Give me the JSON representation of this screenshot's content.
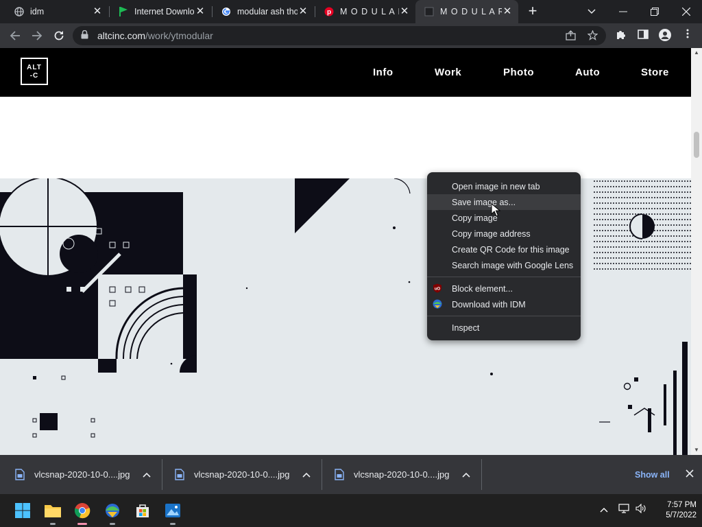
{
  "browser": {
    "tabs": [
      {
        "title": "idm",
        "favicon": "globe-icon",
        "active": false
      },
      {
        "title": "Internet Downlo",
        "favicon": "green-flag-icon",
        "active": false
      },
      {
        "title": "modular ash tho",
        "favicon": "google-icon",
        "active": false
      },
      {
        "title": "M O D U L A R",
        "favicon": "pinterest-icon",
        "active": false
      },
      {
        "title": "M O D U L A R",
        "favicon": "blank-page-icon",
        "active": true
      }
    ],
    "new_tab": "+",
    "url_host": "altcinc.com",
    "url_path": "/work/ytmodular"
  },
  "site": {
    "logo_line1": "ALT",
    "logo_line2": "-C",
    "nav": [
      "Info",
      "Work",
      "Photo",
      "Auto",
      "Store"
    ]
  },
  "context_menu": {
    "items": [
      {
        "label": "Open image in new tab",
        "icon": null,
        "hover": false
      },
      {
        "label": "Save image as...",
        "icon": null,
        "hover": true
      },
      {
        "label": "Copy image",
        "icon": null,
        "hover": false
      },
      {
        "label": "Copy image address",
        "icon": null,
        "hover": false
      },
      {
        "label": "Create QR Code for this image",
        "icon": null,
        "hover": false
      },
      {
        "label": "Search image with Google Lens",
        "icon": null,
        "hover": false
      },
      {
        "separator": true
      },
      {
        "label": "Block element...",
        "icon": "ublock-icon",
        "hover": false
      },
      {
        "label": "Download with IDM",
        "icon": "idm-icon",
        "hover": false
      },
      {
        "separator": true
      },
      {
        "label": "Inspect",
        "icon": null,
        "hover": false
      }
    ]
  },
  "downloads": {
    "items": [
      {
        "filename": "vlcsnap-2020-10-0....jpg"
      },
      {
        "filename": "vlcsnap-2020-10-0....jpg"
      },
      {
        "filename": "vlcsnap-2020-10-0....jpg"
      }
    ],
    "show_all": "Show all"
  },
  "taskbar": {
    "time": "7:57 PM",
    "date": "5/7/2022"
  },
  "colors": {
    "accent": "#8ab4f8",
    "artwork_bg": "#e4e9ec",
    "menu_bg": "#292a2d"
  }
}
